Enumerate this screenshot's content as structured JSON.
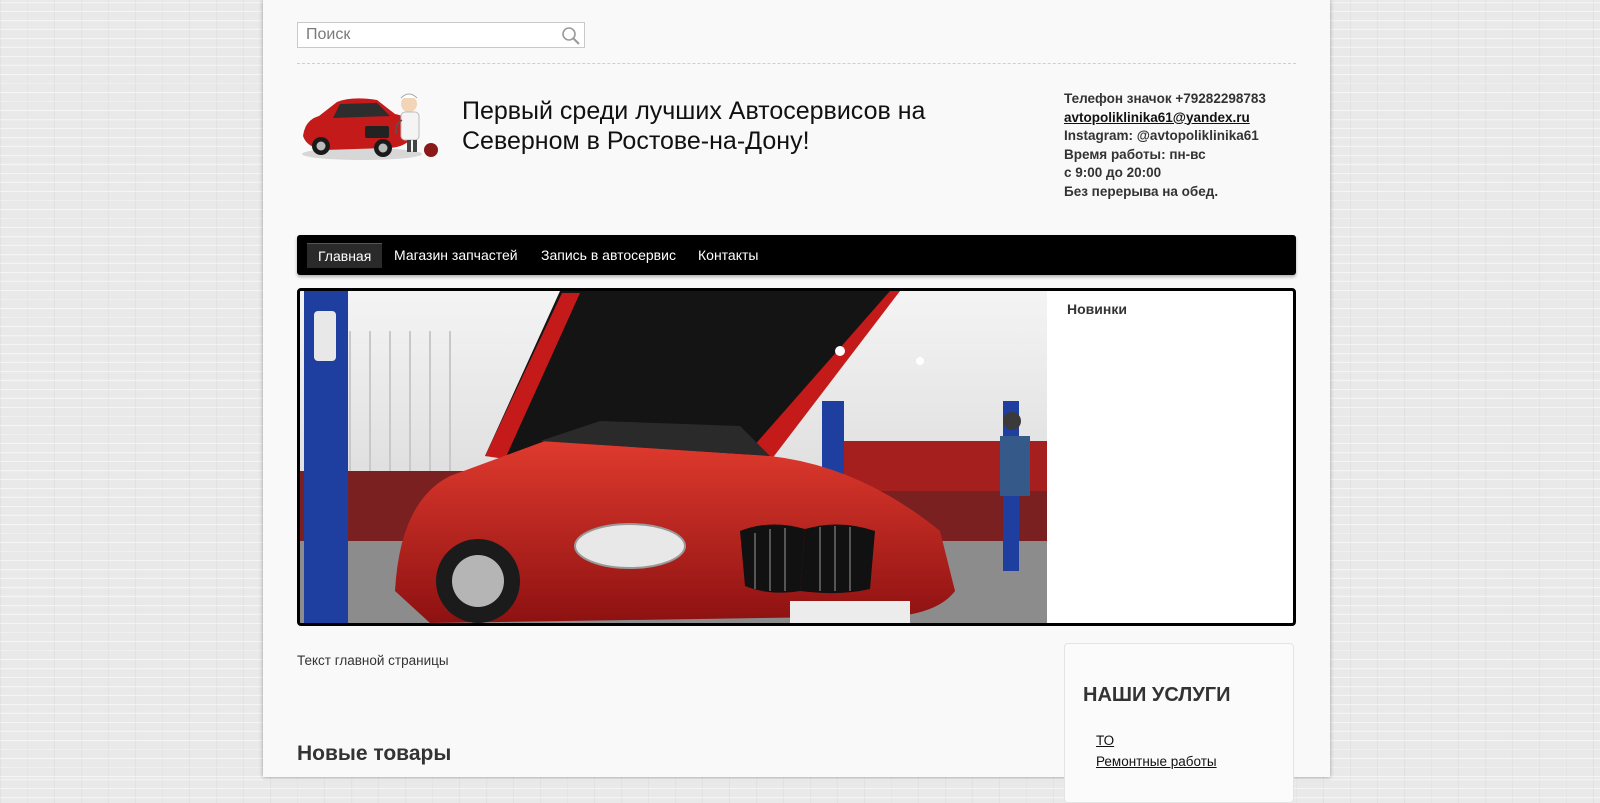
{
  "search": {
    "placeholder": "Поиск"
  },
  "header": {
    "headline": "Первый среди лучших Автосервисов на Северном в Ростове-на-Дону!",
    "contacts": {
      "phone": "Телефон значок +79282298783",
      "email": "avtopoliklinika61@yandex.ru",
      "instagram": "Instagram: @avtopoliklinika61",
      "hours_label": "Время работы: пн-вс",
      "hours": "с 9:00 до 20:00",
      "break": "Без перерыва на обед."
    }
  },
  "nav": {
    "items": [
      {
        "label": "Главная",
        "active": true
      },
      {
        "label": "Магазин запчастей"
      },
      {
        "label": "Запись в автосервис"
      },
      {
        "label": "Контакты"
      }
    ]
  },
  "slider": {
    "news_title": "Новинки"
  },
  "main": {
    "intro_text": "Текст главной страницы",
    "new_goods_title": "Новые товары"
  },
  "services": {
    "title": "НАШИ УСЛУГИ",
    "items": [
      {
        "label": "ТО"
      },
      {
        "label": "Ремонтные работы"
      }
    ]
  },
  "colors": {
    "nav_bg": "#000000",
    "car_red": "#c41a1a",
    "lift_blue": "#1f3fa0"
  }
}
